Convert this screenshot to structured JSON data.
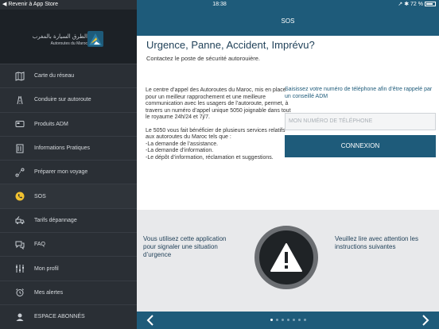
{
  "statusbar": {
    "back_label": "◀ Revenir à App Store",
    "time": "18:38",
    "battery": "↗ ✱ 72 %"
  },
  "sidebar": {
    "logo": {
      "arabic": "الطرق السيارة بالمغرب",
      "french": "Autoroutes du Maroc"
    },
    "items": [
      {
        "label": "Carte du réseau",
        "icon": "map-icon"
      },
      {
        "label": "Conduire sur autoroute",
        "icon": "road-icon"
      },
      {
        "label": "Produits ADM",
        "icon": "card-icon"
      },
      {
        "label": "Informations Pratiques",
        "icon": "info-icon"
      },
      {
        "label": "Préparer mon voyage",
        "icon": "route-icon"
      },
      {
        "label": "SOS",
        "icon": "phone-icon"
      },
      {
        "label": "Tarifs dépannage",
        "icon": "tow-truck-icon"
      },
      {
        "label": "FAQ",
        "icon": "chat-icon"
      },
      {
        "label": "Mon profil",
        "icon": "settings-sliders-icon"
      },
      {
        "label": "Mes alertes",
        "icon": "alarm-clock-icon"
      },
      {
        "label": "ESPACE ABONNÉS",
        "icon": "user-icon"
      }
    ],
    "active_index": 5
  },
  "topbar": {
    "title": "SOS"
  },
  "main": {
    "headline": "Urgence, Panne, Accident, Imprévu?",
    "subline": "Contactez le poste de sécurité autorouière.",
    "info_p1": "Le centre d’appel des Autoroutes du Maroc, mis en place pour un meilleur rapprochement et une meilleure communication avec les usagers de l’autoroute, permet, à travers un numéro d’appel unique 5050 joignable dans tout le royaume 24h/24 et 7j/7.",
    "info_p2_intro": "Le 5050 vous fait bénéficier de plusieurs services relatifs aux autoroutes du Maroc tels que :",
    "info_line1": "-La demande de l’assistance.",
    "info_line2": "-La demande d’information.",
    "info_line3": "-Le dépôt d’information, réclamation et suggestions."
  },
  "form": {
    "label": "Saisissez votre numéro de téléphone afin d’être rappelé par un conseillé ADM",
    "placeholder": "MON NUMÉRO DE TÉLÉPHONE",
    "button": "CONNEXION"
  },
  "panel": {
    "left_text": "Vous utilisez cette application pour signaler une situation d’urgence",
    "right_text": "Veuillez lire avec attention les instructions suivantes",
    "icon": "warning-triangle-icon"
  },
  "pager": {
    "count": 7,
    "active": 0
  },
  "colors": {
    "primary": "#1e5b7a",
    "sidebar": "#2a2f35",
    "panel": "#e8e9eb"
  }
}
